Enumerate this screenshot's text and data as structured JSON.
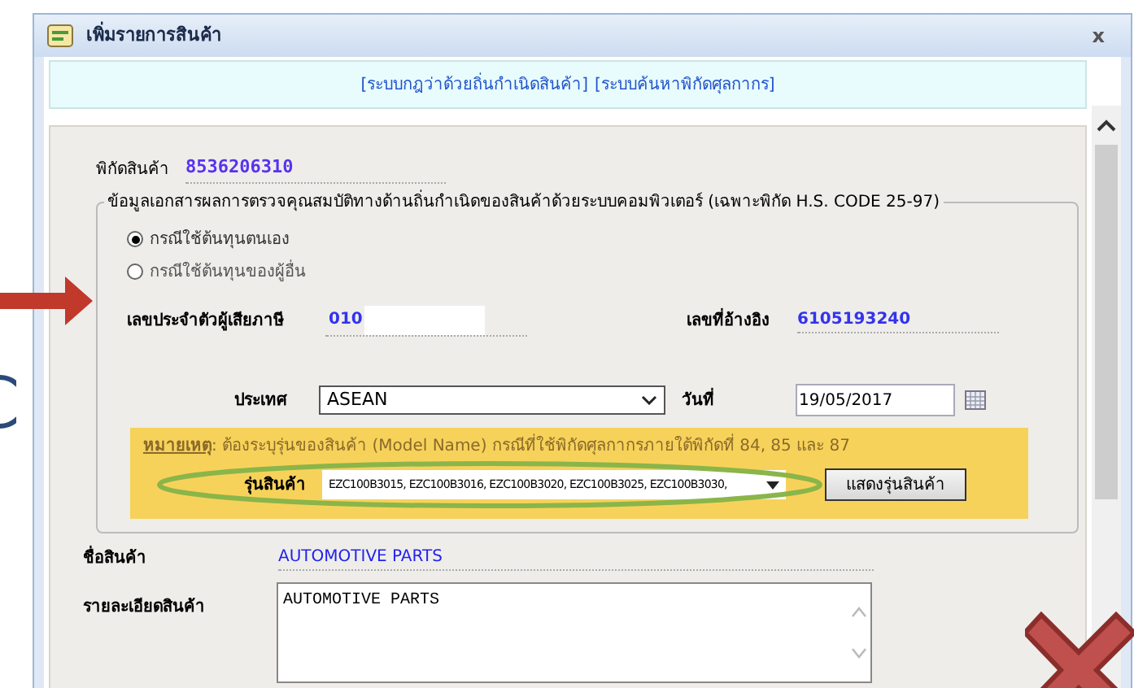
{
  "window": {
    "title": "เพิ่มรายการสินค้า",
    "close": "x"
  },
  "links": [
    "[ระบบกฎว่าด้วยถิ่นกำเนิดสินค้า]",
    "[ระบบค้นหาพิกัดศุลกากร]"
  ],
  "hs_code": {
    "label": "พิกัดสินค้า",
    "value": "8536206310"
  },
  "fieldset": {
    "legend": "ข้อมูลเอกสารผลการตรวจคุณสมบัติทางด้านถิ่นกำเนิดของสินค้าด้วยระบบคอมพิวเตอร์ (เฉพาะพิกัด H.S. CODE 25-97)",
    "options": [
      {
        "label": "กรณีใช้ต้นทุนตนเอง",
        "selected": true
      },
      {
        "label": "กรณีใช้ต้นทุนของผู้อื่น",
        "selected": false
      }
    ],
    "taxpayer": {
      "label": "เลขประจำตัวผู้เสียภาษี",
      "value": "010"
    },
    "reference": {
      "label": "เลขที่อ้างอิง",
      "value": "6105193240"
    },
    "country": {
      "label": "ประเทศ",
      "value": "ASEAN"
    },
    "date": {
      "label": "วันที่",
      "value": "19/05/2017"
    },
    "note": {
      "label": "หมายเหตุ",
      "text": ": ต้องระบุรุ่นของสินค้า (Model Name) กรณีที่ใช้พิกัดศุลกากรภายใต้พิกัดที่ 84, 85 และ 87"
    },
    "model": {
      "label": "รุ่นสินค้า",
      "value": "EZC100B3015, EZC100B3016, EZC100B3020, EZC100B3025, EZC100B3030,",
      "button": "แสดงรุ่นสินค้า"
    }
  },
  "product_name": {
    "label": "ชื่อสินค้า",
    "value": "AUTOMOTIVE PARTS"
  },
  "product_detail": {
    "label": "รายละเอียดสินค้า",
    "value": "AUTOMOTIVE PARTS"
  }
}
